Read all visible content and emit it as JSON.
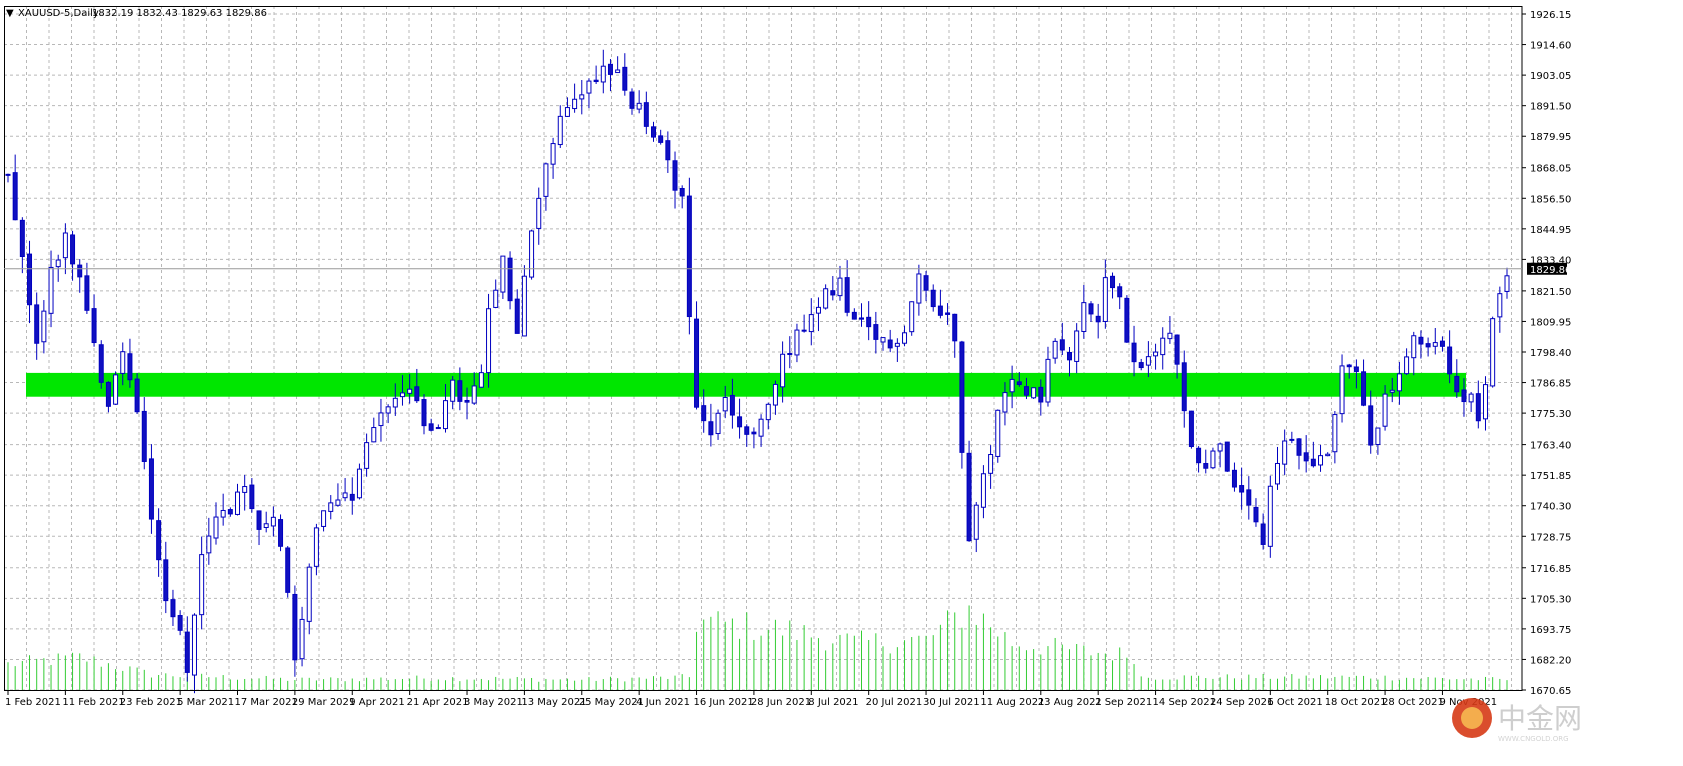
{
  "header": {
    "menu_glyph": "▼",
    "symbol_timeframe": "XAUUSD-5,Daily",
    "ohlc": "1832.19 1832.43 1829.63 1829.86"
  },
  "watermark": {
    "text": "中金网",
    "sub": "WWW.CNGOLD.ORG"
  },
  "colors": {
    "bull_fill": "#ffffff",
    "bull_outline": "#0000c0",
    "bear_fill": "#1010c0",
    "zone": "#00e600",
    "volume": "#33cc33",
    "grid": "#b8b8b8",
    "current_price_label_bg": "#000000",
    "current_price_label_text": "#ffffff"
  },
  "chart_data": {
    "type": "candlestick",
    "symbol": "XAUUSD-5",
    "timeframe": "Daily",
    "y_range": [
      1670.65,
      1926.15
    ],
    "price_ticks": [
      "1926.15",
      "1914.60",
      "1903.05",
      "1891.50",
      "1879.95",
      "1868.05",
      "1856.50",
      "1844.95",
      "1833.40",
      "1821.50",
      "1809.95",
      "1798.40",
      "1786.85",
      "1775.30",
      "1763.40",
      "1751.85",
      "1740.30",
      "1728.75",
      "1716.85",
      "1705.30",
      "1693.75",
      "1682.20",
      "1670.65"
    ],
    "current_price": "1829.86",
    "support_zone": [
      1781.5,
      1790.5
    ],
    "date_labels": [
      {
        "label": "1 Feb 2021",
        "index": 0
      },
      {
        "label": "11 Feb 2021",
        "index": 8
      },
      {
        "label": "23 Feb 2021",
        "index": 16
      },
      {
        "label": "5 Mar 2021",
        "index": 24
      },
      {
        "label": "17 Mar 2021",
        "index": 32
      },
      {
        "label": "29 Mar 2021",
        "index": 40
      },
      {
        "label": "9 Apr 2021",
        "index": 48
      },
      {
        "label": "21 Apr 2021",
        "index": 56
      },
      {
        "label": "3 May 2021",
        "index": 64
      },
      {
        "label": "13 May 2021",
        "index": 72
      },
      {
        "label": "25 May 2021",
        "index": 80
      },
      {
        "label": "4 Jun 2021",
        "index": 88
      },
      {
        "label": "16 Jun 2021",
        "index": 96
      },
      {
        "label": "28 Jun 2021",
        "index": 104
      },
      {
        "label": "8 Jul 2021",
        "index": 112
      },
      {
        "label": "20 Jul 2021",
        "index": 120
      },
      {
        "label": "30 Jul 2021",
        "index": 128
      },
      {
        "label": "11 Aug 2021",
        "index": 136
      },
      {
        "label": "23 Aug 2021",
        "index": 144
      },
      {
        "label": "2 Sep 2021",
        "index": 152
      },
      {
        "label": "14 Sep 2021",
        "index": 160
      },
      {
        "label": "24 Sep 2021",
        "index": 168
      },
      {
        "label": "6 Oct 2021",
        "index": 176
      },
      {
        "label": "18 Oct 2021",
        "index": 184
      },
      {
        "label": "28 Oct 2021",
        "index": 192
      },
      {
        "label": "9 Nov 2021",
        "index": 200
      }
    ],
    "close_anchors": [
      [
        0,
        1863
      ],
      [
        2,
        1835
      ],
      [
        4,
        1800
      ],
      [
        6,
        1830
      ],
      [
        8,
        1842
      ],
      [
        10,
        1825
      ],
      [
        12,
        1800
      ],
      [
        14,
        1778
      ],
      [
        16,
        1800
      ],
      [
        18,
        1775
      ],
      [
        20,
        1738
      ],
      [
        22,
        1705
      ],
      [
        24,
        1692
      ],
      [
        25,
        1680
      ],
      [
        27,
        1720
      ],
      [
        29,
        1735
      ],
      [
        31,
        1740
      ],
      [
        33,
        1745
      ],
      [
        35,
        1730
      ],
      [
        37,
        1738
      ],
      [
        39,
        1710
      ],
      [
        40,
        1680
      ],
      [
        42,
        1720
      ],
      [
        44,
        1740
      ],
      [
        46,
        1745
      ],
      [
        48,
        1745
      ],
      [
        50,
        1765
      ],
      [
        52,
        1775
      ],
      [
        54,
        1782
      ],
      [
        56,
        1785
      ],
      [
        58,
        1770
      ],
      [
        60,
        1772
      ],
      [
        62,
        1785
      ],
      [
        64,
        1778
      ],
      [
        66,
        1790
      ],
      [
        67,
        1812
      ],
      [
        69,
        1832
      ],
      [
        71,
        1805
      ],
      [
        73,
        1845
      ],
      [
        75,
        1870
      ],
      [
        77,
        1885
      ],
      [
        79,
        1895
      ],
      [
        81,
        1900
      ],
      [
        83,
        1906
      ],
      [
        85,
        1904
      ],
      [
        86,
        1895
      ],
      [
        88,
        1890
      ],
      [
        90,
        1880
      ],
      [
        92,
        1870
      ],
      [
        94,
        1855
      ],
      [
        95,
        1812
      ],
      [
        96,
        1775
      ],
      [
        98,
        1768
      ],
      [
        100,
        1780
      ],
      [
        102,
        1770
      ],
      [
        104,
        1765
      ],
      [
        106,
        1778
      ],
      [
        108,
        1795
      ],
      [
        110,
        1805
      ],
      [
        112,
        1810
      ],
      [
        114,
        1820
      ],
      [
        116,
        1825
      ],
      [
        117,
        1812
      ],
      [
        119,
        1808
      ],
      [
        121,
        1803
      ],
      [
        123,
        1800
      ],
      [
        125,
        1808
      ],
      [
        127,
        1828
      ],
      [
        129,
        1815
      ],
      [
        131,
        1812
      ],
      [
        132,
        1805
      ],
      [
        133,
        1763
      ],
      [
        134,
        1730
      ],
      [
        136,
        1750
      ],
      [
        138,
        1775
      ],
      [
        140,
        1787
      ],
      [
        142,
        1785
      ],
      [
        144,
        1782
      ],
      [
        146,
        1805
      ],
      [
        148,
        1798
      ],
      [
        150,
        1815
      ],
      [
        152,
        1810
      ],
      [
        153,
        1828
      ],
      [
        155,
        1820
      ],
      [
        156,
        1800
      ],
      [
        158,
        1790
      ],
      [
        160,
        1800
      ],
      [
        162,
        1805
      ],
      [
        163,
        1795
      ],
      [
        165,
        1762
      ],
      [
        167,
        1755
      ],
      [
        169,
        1765
      ],
      [
        171,
        1745
      ],
      [
        173,
        1740
      ],
      [
        175,
        1725
      ],
      [
        176,
        1745
      ],
      [
        178,
        1765
      ],
      [
        180,
        1760
      ],
      [
        182,
        1758
      ],
      [
        184,
        1760
      ],
      [
        186,
        1793
      ],
      [
        188,
        1790
      ],
      [
        190,
        1765
      ],
      [
        192,
        1780
      ],
      [
        194,
        1790
      ],
      [
        196,
        1802
      ],
      [
        198,
        1800
      ],
      [
        200,
        1800
      ],
      [
        202,
        1785
      ],
      [
        204,
        1780
      ],
      [
        205,
        1770
      ],
      [
        206,
        1788
      ],
      [
        207,
        1810
      ],
      [
        208,
        1822
      ],
      [
        209,
        1830
      ]
    ],
    "volume_profile": [
      [
        0,
        0.3
      ],
      [
        10,
        0.38
      ],
      [
        20,
        0.18
      ],
      [
        40,
        0.12
      ],
      [
        60,
        0.14
      ],
      [
        80,
        0.12
      ],
      [
        95,
        0.15
      ],
      [
        96,
        0.8
      ],
      [
        108,
        0.7
      ],
      [
        118,
        0.55
      ],
      [
        128,
        0.58
      ],
      [
        134,
        0.95
      ],
      [
        140,
        0.55
      ],
      [
        150,
        0.45
      ],
      [
        157,
        0.4
      ],
      [
        158,
        0.15
      ],
      [
        170,
        0.15
      ],
      [
        190,
        0.15
      ],
      [
        209,
        0.12
      ]
    ],
    "bar_count": 210
  }
}
